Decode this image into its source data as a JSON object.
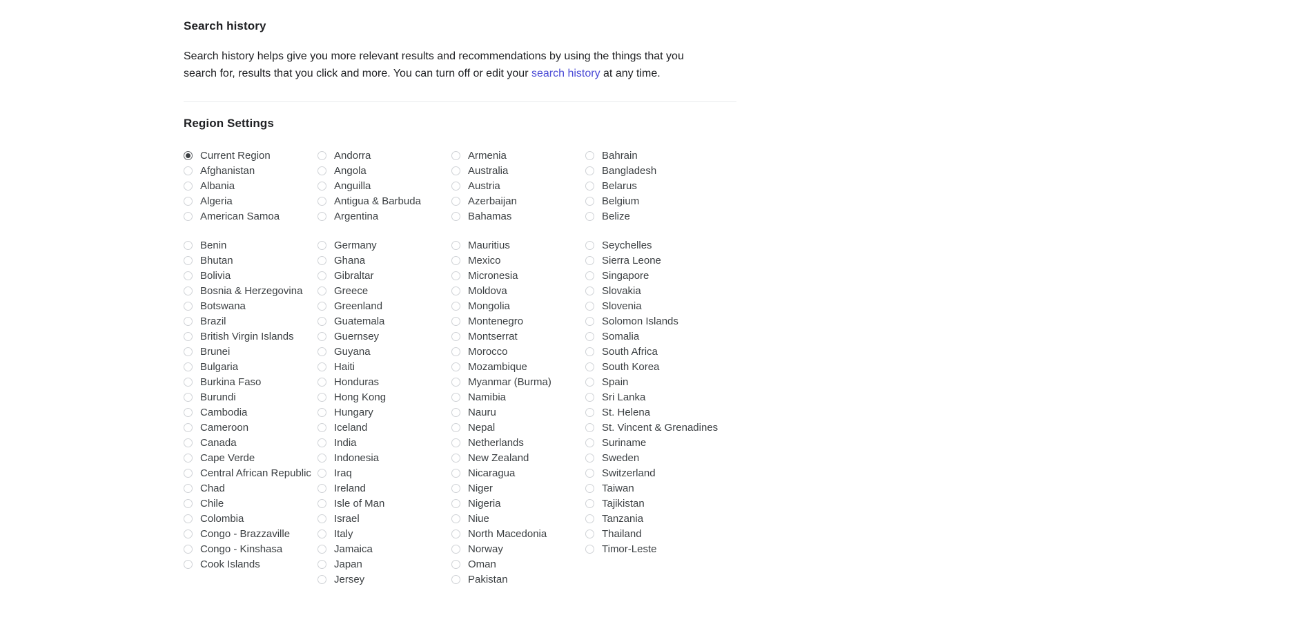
{
  "search_history": {
    "heading": "Search history",
    "body_before_link": "Search history helps give you more relevant results and recommendations by using the things that you search for, results that you click and more. You can turn off or edit your ",
    "link_text": "search history",
    "body_after_link": " at any time.",
    "link_color": "#4b4bd6"
  },
  "region_settings": {
    "heading": "Region Settings",
    "selected": "Current Region",
    "groups": [
      {
        "columns": [
          [
            "Current Region",
            "Afghanistan",
            "Albania",
            "Algeria",
            "American Samoa"
          ],
          [
            "Andorra",
            "Angola",
            "Anguilla",
            "Antigua & Barbuda",
            "Argentina"
          ],
          [
            "Armenia",
            "Australia",
            "Austria",
            "Azerbaijan",
            "Bahamas"
          ],
          [
            "Bahrain",
            "Bangladesh",
            "Belarus",
            "Belgium",
            "Belize"
          ]
        ]
      },
      {
        "columns": [
          [
            "Benin",
            "Bhutan",
            "Bolivia",
            "Bosnia & Herzegovina",
            "Botswana",
            "Brazil",
            "British Virgin Islands",
            "Brunei",
            "Bulgaria",
            "Burkina Faso",
            "Burundi",
            "Cambodia",
            "Cameroon",
            "Canada",
            "Cape Verde",
            "Central African Republic",
            "Chad",
            "Chile",
            "Colombia",
            "Congo - Brazzaville",
            "Congo - Kinshasa",
            "Cook Islands"
          ],
          [
            "Germany",
            "Ghana",
            "Gibraltar",
            "Greece",
            "Greenland",
            "Guatemala",
            "Guernsey",
            "Guyana",
            "Haiti",
            "Honduras",
            "Hong Kong",
            "Hungary",
            "Iceland",
            "India",
            "Indonesia",
            "Iraq",
            "Ireland",
            "Isle of Man",
            "Israel",
            "Italy",
            "Jamaica",
            "Japan",
            "Jersey"
          ],
          [
            "Mauritius",
            "Mexico",
            "Micronesia",
            "Moldova",
            "Mongolia",
            "Montenegro",
            "Montserrat",
            "Morocco",
            "Mozambique",
            "Myanmar (Burma)",
            "Namibia",
            "Nauru",
            "Nepal",
            "Netherlands",
            "New Zealand",
            "Nicaragua",
            "Niger",
            "Nigeria",
            "Niue",
            "North Macedonia",
            "Norway",
            "Oman",
            "Pakistan"
          ],
          [
            "Seychelles",
            "Sierra Leone",
            "Singapore",
            "Slovakia",
            "Slovenia",
            "Solomon Islands",
            "Somalia",
            "South Africa",
            "South Korea",
            "Spain",
            "Sri Lanka",
            "St. Helena",
            "St. Vincent & Grenadines",
            "Suriname",
            "Sweden",
            "Switzerland",
            "Taiwan",
            "Tajikistan",
            "Tanzania",
            "Thailand",
            "Timor-Leste"
          ]
        ]
      }
    ]
  }
}
